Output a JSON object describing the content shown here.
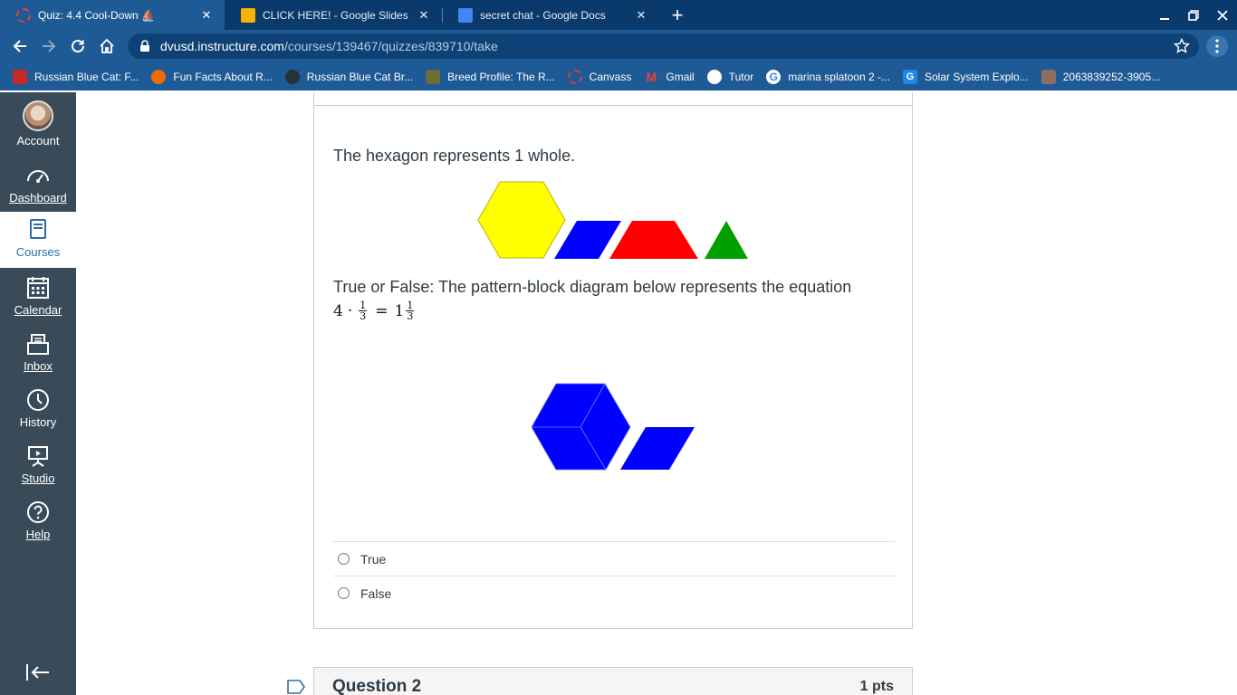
{
  "tabs": [
    {
      "title": "Quiz: 4.4 Cool-Down ⛵",
      "active": true
    },
    {
      "title": "CLICK HERE! - Google Slides",
      "active": false
    },
    {
      "title": "secret chat - Google Docs",
      "active": false
    }
  ],
  "address_bar": {
    "host": "dvusd.instructure.com",
    "path": "/courses/139467/quizzes/839710/take"
  },
  "bookmarks": [
    {
      "label": "Russian Blue Cat: F...",
      "color": "#c62828"
    },
    {
      "label": "Fun Facts About R...",
      "color": "#ef6c00"
    },
    {
      "label": "Russian Blue Cat Br...",
      "color": "#263238"
    },
    {
      "label": "Breed Profile: The R...",
      "color": "#6d6d3a"
    },
    {
      "label": "Canvass",
      "color": "#e53935"
    },
    {
      "label": "Gmail",
      "color": "#ea4335"
    },
    {
      "label": "Tutor",
      "color": "#ffffff"
    },
    {
      "label": "marina splatoon 2 -...",
      "color": "#ffffff"
    },
    {
      "label": "Solar System Explo...",
      "color": "#1e88e5"
    },
    {
      "label": "2063839252-3905...",
      "color": "#8d6e63"
    }
  ],
  "sidebar": {
    "items": [
      {
        "label": "Account"
      },
      {
        "label": "Dashboard"
      },
      {
        "label": "Courses"
      },
      {
        "label": "Calendar"
      },
      {
        "label": "Inbox"
      },
      {
        "label": "History"
      },
      {
        "label": "Studio"
      },
      {
        "label": "Help"
      }
    ],
    "active": "Courses"
  },
  "question1": {
    "intro": "The hexagon represents 1 whole.",
    "prompt": "True or False: The pattern-block diagram below represents the equation",
    "equation": {
      "a": "4",
      "dot": "·",
      "num1": "1",
      "den1": "3",
      "eq": "=",
      "whole": "1",
      "num2": "1",
      "den2": "3"
    },
    "answers": [
      "True",
      "False"
    ]
  },
  "question2": {
    "title": "Question 2",
    "points": "1 pts"
  },
  "colors": {
    "hexagon": "#ffff00",
    "rhombus": "#0000ff",
    "trapezoid": "#ff0000",
    "triangle": "#00a000",
    "sidebar": "#394b58",
    "chrome": "#1e5a95"
  }
}
